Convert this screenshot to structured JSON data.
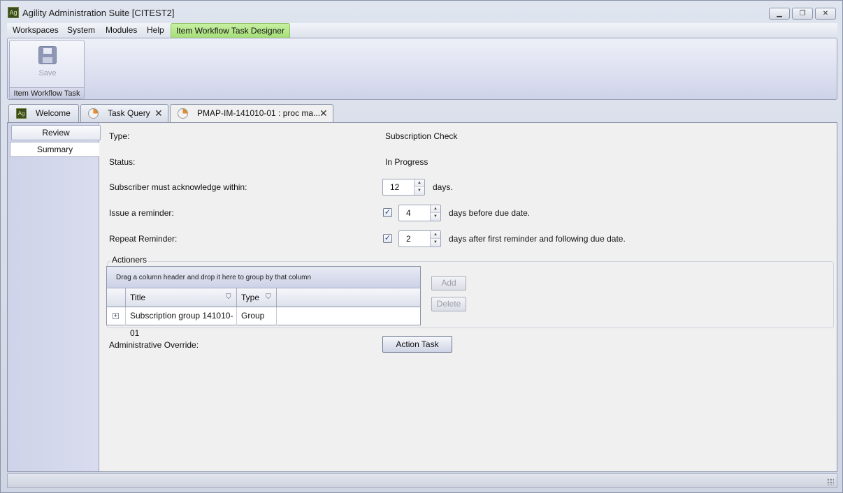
{
  "window": {
    "title": "Agility Administration Suite [CITEST2]",
    "app_icon": "Ag"
  },
  "menu": [
    "Workspaces",
    "System",
    "Modules",
    "Help"
  ],
  "active_menu": "Item Workflow Task Designer",
  "ribbon": {
    "save_label": "Save",
    "group_caption": "Item Workflow Task"
  },
  "tabs": {
    "welcome": "Welcome",
    "task_query": "Task Query",
    "pmap": "PMAP-IM-141010-01 : proc ma..."
  },
  "side_nav": {
    "review": "Review",
    "summary": "Summary"
  },
  "form": {
    "type_label": "Type:",
    "type_value": "Subscription Check",
    "status_label": "Status:",
    "status_value": "In Progress",
    "ack_label": "Subscriber must acknowledge within:",
    "ack_value": "12",
    "ack_suffix": "days.",
    "reminder_label": "Issue a reminder:",
    "reminder_checked": true,
    "reminder_value": "4",
    "reminder_suffix": "days before due date.",
    "repeat_label": "Repeat Reminder:",
    "repeat_checked": true,
    "repeat_value": "2",
    "repeat_suffix": "days after first reminder and following due date.",
    "override_label": "Administrative Override:",
    "action_task_label": "Action Task"
  },
  "actioners": {
    "legend": "Actioners",
    "group_hint": "Drag a column header and drop it here to group by that column",
    "columns": [
      "Title",
      "Type"
    ],
    "rows": [
      {
        "title": "Subscription group 141010-01",
        "type": "Group"
      }
    ],
    "add_label": "Add",
    "delete_label": "Delete"
  },
  "icons": {
    "close": "✕",
    "filter": "⛉",
    "check": "✓",
    "expand": "+"
  }
}
